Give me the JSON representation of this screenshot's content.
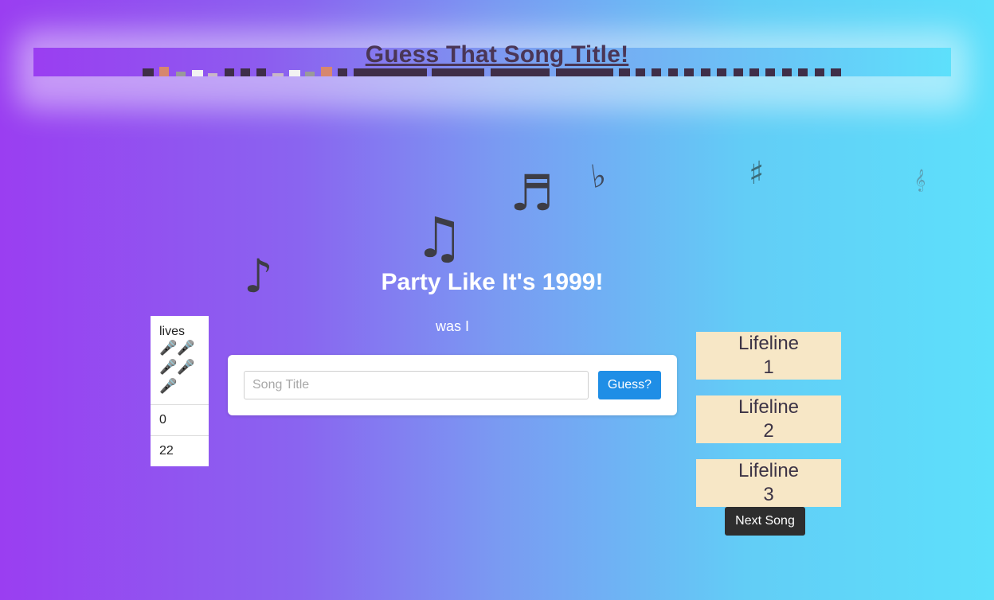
{
  "header": {
    "title": "Guess That Song Title!"
  },
  "game": {
    "song_hint_title": "Party Like It's 1999!",
    "partial_answer": "was I"
  },
  "stats": {
    "lives_label": "lives",
    "lives_icons": "🎤🎤🎤🎤🎤",
    "score": "0",
    "count": "22"
  },
  "guess_form": {
    "placeholder": "Song Title",
    "submit_label": "Guess?"
  },
  "lifelines": [
    {
      "label": "Lifeline",
      "number": "1"
    },
    {
      "label": "Lifeline",
      "number": "2"
    },
    {
      "label": "Lifeline",
      "number": "3"
    }
  ],
  "next_label": "Next Song",
  "decor": {
    "notes": [
      "♪",
      "♫",
      "♬",
      "♭",
      "♯",
      "𝄞"
    ],
    "eq_bar_colors": [
      "#3f2e48",
      "#d7876e",
      "#9a9a9a",
      "#f2f2f2",
      "#c9b7c7"
    ]
  }
}
